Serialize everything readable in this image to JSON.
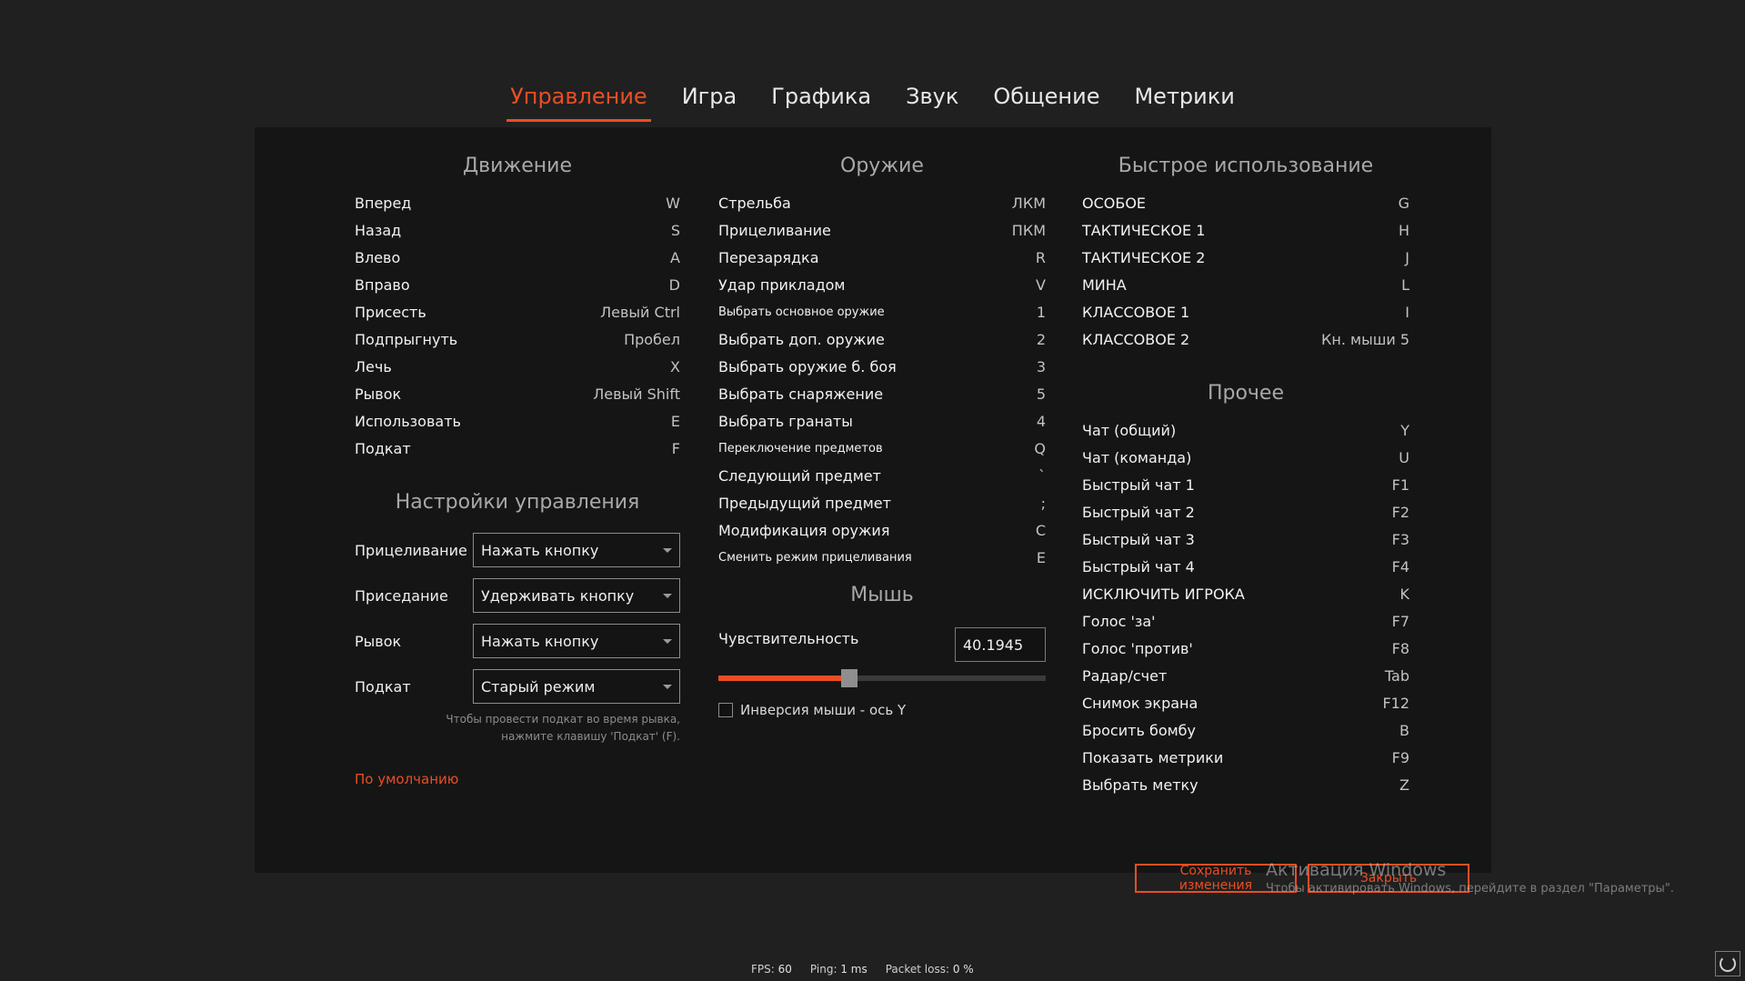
{
  "tabs": [
    {
      "label": "Управление",
      "active": true
    },
    {
      "label": "Игра",
      "active": false
    },
    {
      "label": "Графика",
      "active": false
    },
    {
      "label": "Звук",
      "active": false
    },
    {
      "label": "Общение",
      "active": false
    },
    {
      "label": "Метрики",
      "active": false
    }
  ],
  "movement": {
    "title": "Движение",
    "rows": [
      {
        "action": "Вперед",
        "key": "W"
      },
      {
        "action": "Назад",
        "key": "S"
      },
      {
        "action": "Влево",
        "key": "A"
      },
      {
        "action": "Вправо",
        "key": "D"
      },
      {
        "action": "Присесть",
        "key": "Левый Ctrl"
      },
      {
        "action": "Подпрыгнуть",
        "key": "Пробел"
      },
      {
        "action": "Лечь",
        "key": "X"
      },
      {
        "action": "Рывок",
        "key": "Левый Shift"
      },
      {
        "action": "Использовать",
        "key": "E"
      },
      {
        "action": "Подкат",
        "key": "F"
      }
    ]
  },
  "control_settings": {
    "title": "Настройки управления",
    "items": [
      {
        "label": "Прицеливание",
        "value": "Нажать кнопку"
      },
      {
        "label": "Приседание",
        "value": "Удерживать кнопку"
      },
      {
        "label": "Рывок",
        "value": "Нажать кнопку"
      },
      {
        "label": "Подкат",
        "value": "Старый режим"
      }
    ],
    "hint_line1": "Чтобы провести подкат во время рывка,",
    "hint_line2": "нажмите клавишу 'Подкат' (F).",
    "default_label": "По умолчанию"
  },
  "weapons": {
    "title": "Оружие",
    "rows": [
      {
        "action": "Стрельба",
        "key": "ЛКМ"
      },
      {
        "action": "Прицеливание",
        "key": "ПКМ"
      },
      {
        "action": "Перезарядка",
        "key": "R"
      },
      {
        "action": "Удар прикладом",
        "key": "V"
      },
      {
        "action": "Выбрать основное оружие",
        "key": "1"
      },
      {
        "action": "Выбрать доп. оружие",
        "key": "2"
      },
      {
        "action": "Выбрать оружие б. боя",
        "key": "3"
      },
      {
        "action": "Выбрать снаряжение",
        "key": "5"
      },
      {
        "action": "Выбрать гранаты",
        "key": "4"
      },
      {
        "action": "Переключение предметов",
        "key": "Q"
      },
      {
        "action": "Следующий предмет",
        "key": "`"
      },
      {
        "action": "Предыдущий предмет",
        "key": ";"
      },
      {
        "action": "Модификация оружия",
        "key": "C"
      },
      {
        "action": "Сменить режим прицеливания",
        "key": "E"
      }
    ]
  },
  "mouse": {
    "title": "Мышь",
    "sensitivity_label": "Чувствительность",
    "sensitivity_value": "40.1945",
    "slider_fraction": 0.4,
    "invert_label": "Инверсия мыши - ось Y",
    "invert_checked": false
  },
  "quick_use": {
    "title": "Быстрое использование",
    "rows": [
      {
        "action": "ОСОБОЕ",
        "key": "G"
      },
      {
        "action": "ТАКТИЧЕСКОЕ 1",
        "key": "H"
      },
      {
        "action": "ТАКТИЧЕСКОЕ 2",
        "key": "J"
      },
      {
        "action": "МИНА",
        "key": "L"
      },
      {
        "action": "КЛАССОВОЕ 1",
        "key": "I"
      },
      {
        "action": "КЛАССОВОЕ 2",
        "key": "Кн. мыши 5"
      }
    ]
  },
  "other": {
    "title": "Прочее",
    "rows": [
      {
        "action": "Чат (общий)",
        "key": "Y"
      },
      {
        "action": "Чат (команда)",
        "key": "U"
      },
      {
        "action": "Быстрый чат 1",
        "key": "F1"
      },
      {
        "action": "Быстрый чат 2",
        "key": "F2"
      },
      {
        "action": "Быстрый чат 3",
        "key": "F3"
      },
      {
        "action": "Быстрый чат 4",
        "key": "F4"
      },
      {
        "action": "ИСКЛЮЧИТЬ ИГРОКА",
        "key": "K"
      },
      {
        "action": "Голос 'за'",
        "key": "F7"
      },
      {
        "action": "Голос 'против'",
        "key": "F8"
      },
      {
        "action": "Радар/счет",
        "key": "Tab"
      },
      {
        "action": "Снимок экрана",
        "key": "F12"
      },
      {
        "action": "Бросить бомбу",
        "key": "B"
      },
      {
        "action": "Показать метрики",
        "key": "F9"
      },
      {
        "action": "Выбрать метку",
        "key": "Z"
      }
    ]
  },
  "buttons": {
    "save": "Сохранить изменения",
    "close": "Закрыть"
  },
  "watermark": {
    "line1": "Активация Windows",
    "line2": "Чтобы активировать Windows, перейдите в раздел \"Параметры\"."
  },
  "stats": {
    "fps_label": "FPS:",
    "fps": "60",
    "ping_label": "Ping:",
    "ping": "1 ms",
    "loss_label": "Packet loss:",
    "loss": "0 %"
  },
  "colors": {
    "accent": "#e94e24",
    "panel": "#151515",
    "background": "#202020"
  }
}
